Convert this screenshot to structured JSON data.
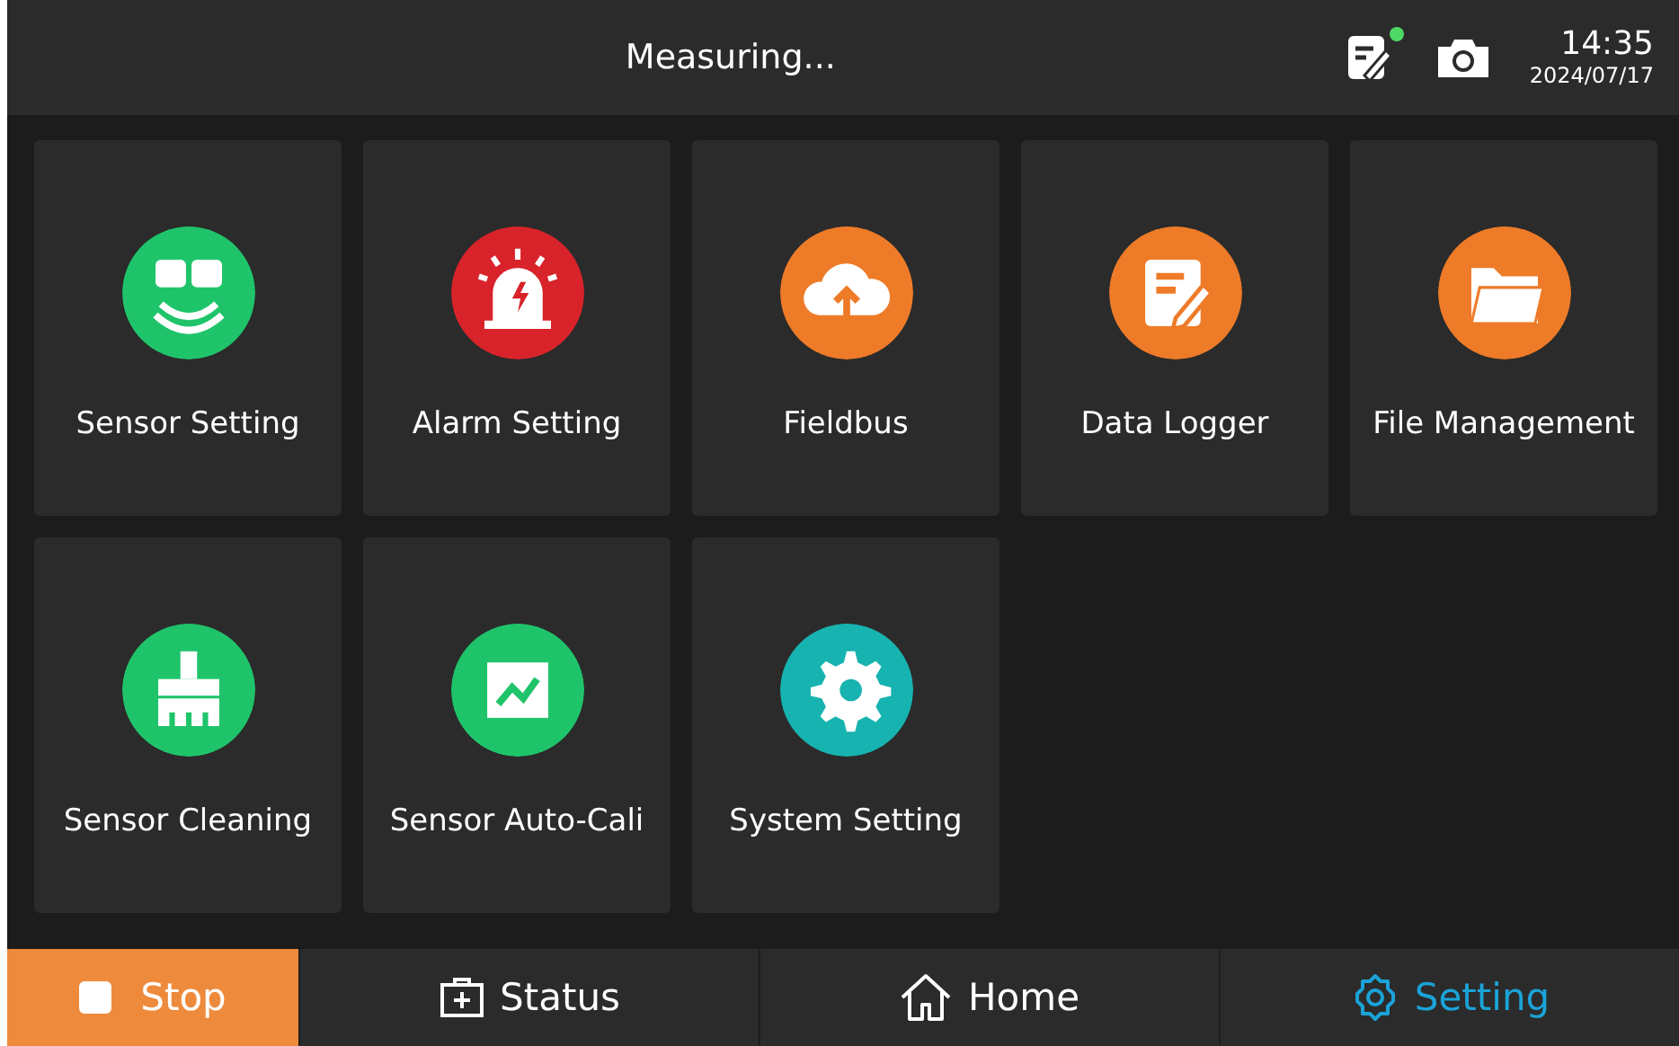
{
  "status_bar": {
    "title": "Measuring...",
    "notes_alert": true,
    "time": "14:35",
    "date": "2024/07/17"
  },
  "tiles": [
    {
      "label": "Sensor Setting",
      "kind": "sensor",
      "color": "#1fc46a"
    },
    {
      "label": "Alarm Setting",
      "kind": "alarm",
      "color": "#d8232a"
    },
    {
      "label": "Fieldbus",
      "kind": "cloud",
      "color": "#ee7b28"
    },
    {
      "label": "Data Logger",
      "kind": "logger",
      "color": "#ee7b28"
    },
    {
      "label": "File Management",
      "kind": "folder",
      "color": "#ee7b28"
    },
    {
      "label": "Sensor Cleaning",
      "kind": "brush",
      "color": "#1fc46a"
    },
    {
      "label": "Sensor Auto-Cali",
      "kind": "chart",
      "color": "#1fc46a"
    },
    {
      "label": "System Setting",
      "kind": "gear",
      "color": "#17b3b0"
    }
  ],
  "nav": [
    {
      "label": "Stop",
      "kind": "stop",
      "selected": false
    },
    {
      "label": "Status",
      "kind": "status",
      "selected": false
    },
    {
      "label": "Home",
      "kind": "home",
      "selected": false
    },
    {
      "label": "Setting",
      "kind": "setting",
      "selected": true
    }
  ]
}
